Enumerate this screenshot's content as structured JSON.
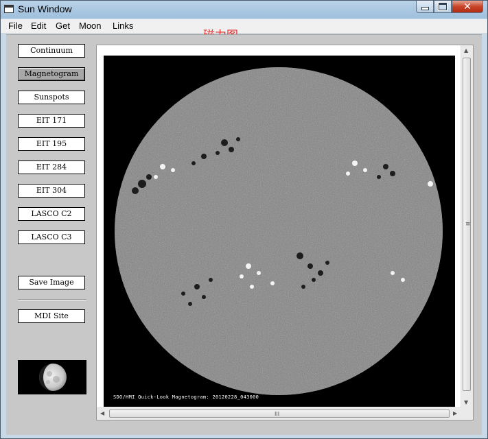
{
  "window": {
    "title": "Sun Window"
  },
  "window_controls": {
    "min": "",
    "max": "",
    "close": "✕"
  },
  "menu": [
    "File",
    "Edit",
    "Get",
    "Moon",
    "Links"
  ],
  "header_label": "磁力图",
  "sidebar": {
    "buttons": [
      {
        "label": "Continuum",
        "pressed": false
      },
      {
        "label": "Magnetogram",
        "pressed": true
      },
      {
        "label": "Sunspots",
        "pressed": false
      },
      {
        "label": "EIT 171",
        "pressed": false
      },
      {
        "label": "EIT 195",
        "pressed": false
      },
      {
        "label": "EIT 284",
        "pressed": false
      },
      {
        "label": "EIT 304",
        "pressed": false
      },
      {
        "label": "LASCO C2",
        "pressed": false
      },
      {
        "label": "LASCO C3",
        "pressed": false
      }
    ],
    "save_image": "Save Image",
    "mdi_site": "MDI Site"
  },
  "viewer": {
    "caption": "SDO/HMI Quick-Look Magnetogram: 20120228_043000"
  },
  "icons": {
    "window": "window-icon",
    "moon": "moon-phase-icon",
    "scroll_up": "▲",
    "scroll_down": "▼",
    "scroll_left": "◀",
    "scroll_right": "▶",
    "vgrip": "≡",
    "hgrip": "III"
  }
}
